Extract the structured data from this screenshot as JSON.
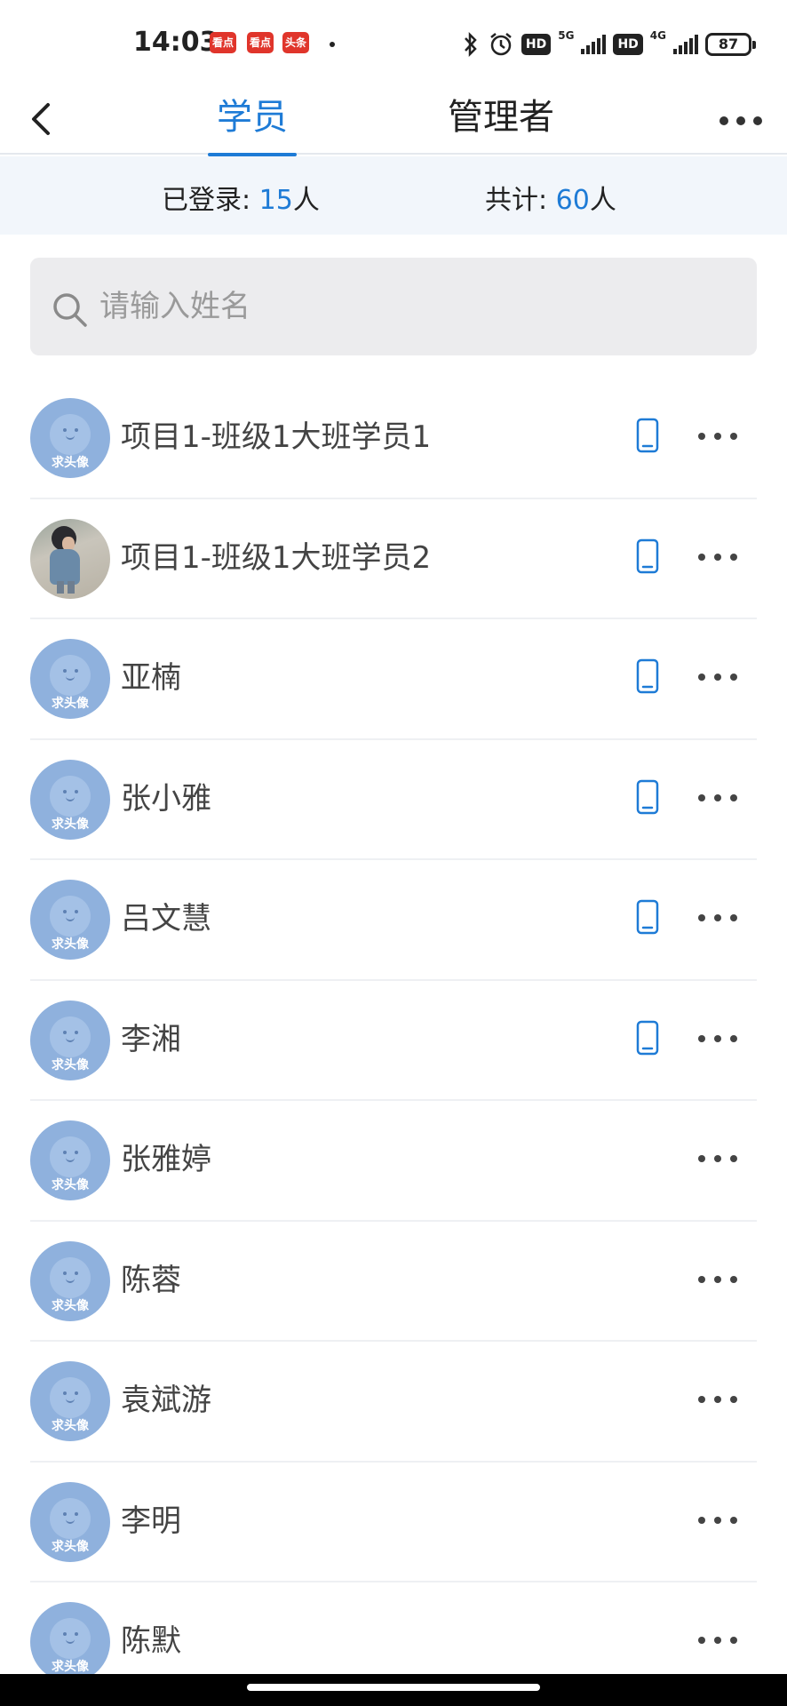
{
  "status_bar": {
    "time": "14:03",
    "apps": [
      "看点",
      "看点",
      "头条"
    ],
    "network_5g": "5G",
    "network_4g": "4G",
    "hd": "HD",
    "battery": "87"
  },
  "header": {
    "tabs": [
      {
        "label": "学员",
        "active": true
      },
      {
        "label": "管理者",
        "active": false
      }
    ]
  },
  "summary": {
    "logged_label": "已登录: ",
    "logged_count": "15",
    "logged_unit": "人",
    "total_label": "共计: ",
    "total_count": "60",
    "total_unit": "人"
  },
  "search": {
    "placeholder": "请输入姓名"
  },
  "avatar_caption": "求头像",
  "accent_color": "#1e7bd6",
  "students": [
    {
      "name": "项目1-班级1大班学员1",
      "has_phone": true,
      "avatar": "default"
    },
    {
      "name": "项目1-班级1大班学员2",
      "has_phone": true,
      "avatar": "photo"
    },
    {
      "name": "亚楠",
      "has_phone": true,
      "avatar": "default"
    },
    {
      "name": "张小雅",
      "has_phone": true,
      "avatar": "default"
    },
    {
      "name": "吕文慧",
      "has_phone": true,
      "avatar": "default"
    },
    {
      "name": "李湘",
      "has_phone": true,
      "avatar": "default"
    },
    {
      "name": "张雅婷",
      "has_phone": false,
      "avatar": "default"
    },
    {
      "name": "陈蓉",
      "has_phone": false,
      "avatar": "default"
    },
    {
      "name": "袁斌游",
      "has_phone": false,
      "avatar": "default"
    },
    {
      "name": "李明",
      "has_phone": false,
      "avatar": "default"
    },
    {
      "name": "陈默",
      "has_phone": false,
      "avatar": "default"
    }
  ]
}
